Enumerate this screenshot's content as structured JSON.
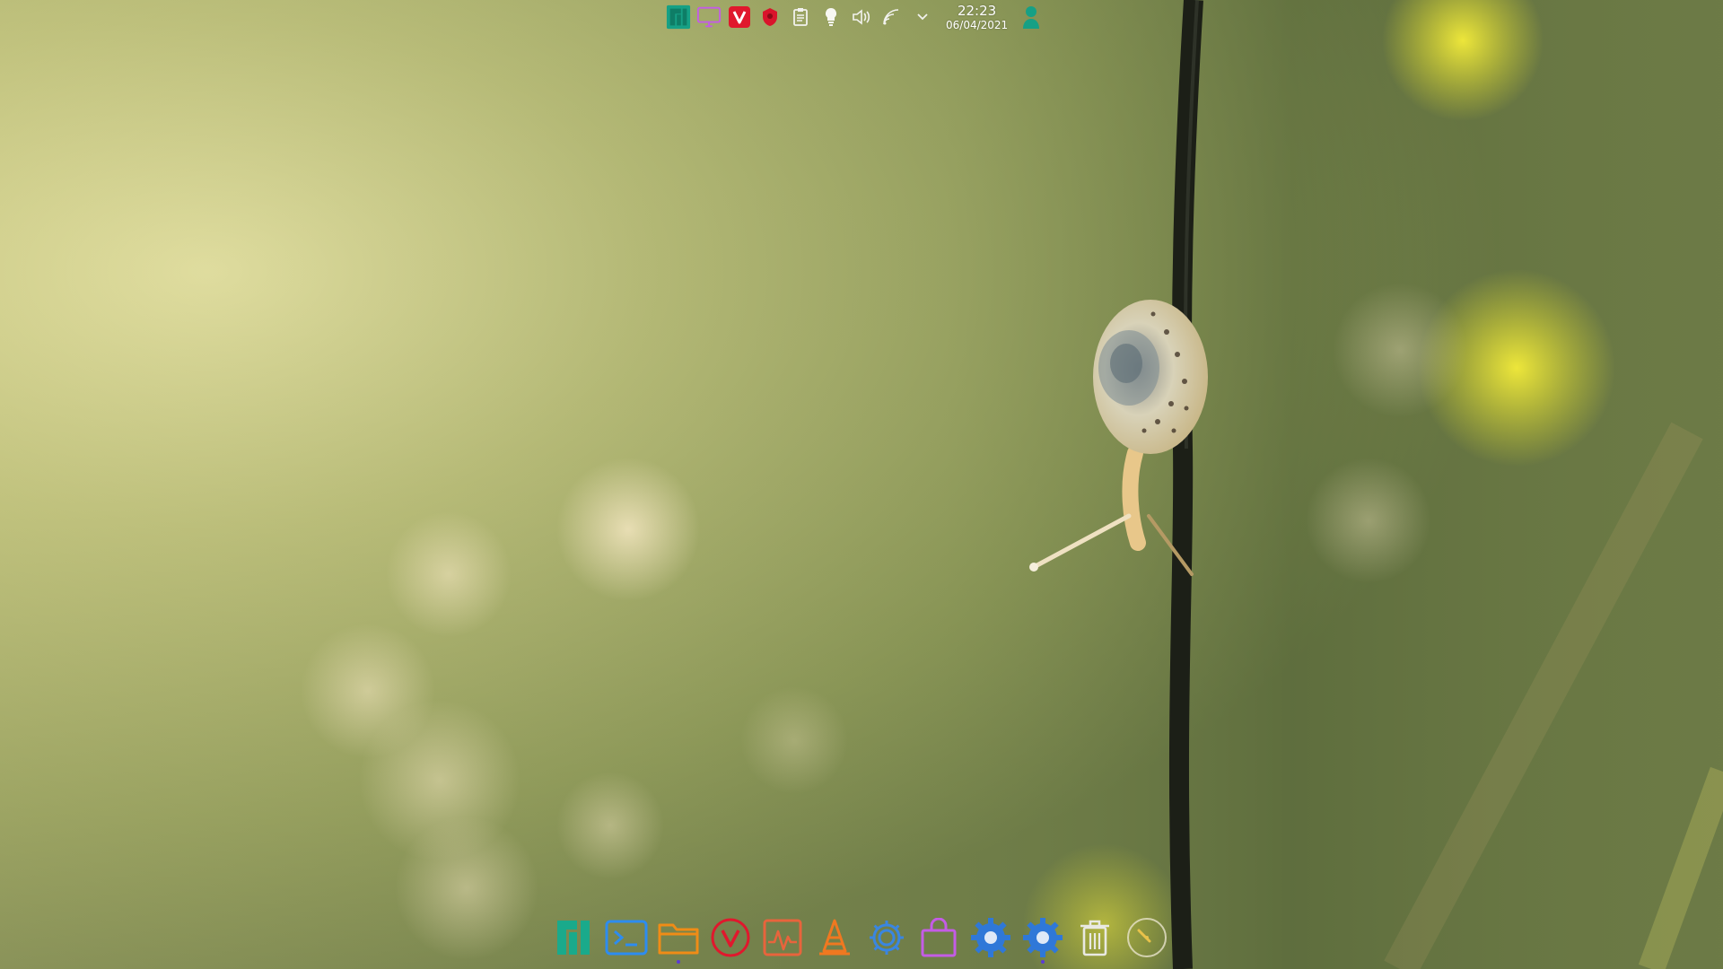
{
  "tray": {
    "items": [
      {
        "name": "manjaro-logo-icon"
      },
      {
        "name": "display-icon"
      },
      {
        "name": "vivaldi-icon"
      },
      {
        "name": "shield-icon"
      },
      {
        "name": "clipboard-icon"
      },
      {
        "name": "lightbulb-icon"
      },
      {
        "name": "volume-icon"
      },
      {
        "name": "wifi-icon"
      },
      {
        "name": "chevron-down-icon"
      }
    ],
    "clock": {
      "time": "22:23",
      "date": "06/04/2021"
    },
    "user": {
      "name": "user-icon"
    }
  },
  "dock": {
    "items": [
      {
        "name": "manjaro-icon",
        "running": false
      },
      {
        "name": "terminal-icon",
        "running": false
      },
      {
        "name": "folder-icon",
        "running": true
      },
      {
        "name": "vivaldi-icon",
        "running": false
      },
      {
        "name": "system-monitor-icon",
        "running": false
      },
      {
        "name": "vlc-cone-icon",
        "running": false
      },
      {
        "name": "settings-gear-icon",
        "running": false
      },
      {
        "name": "shopping-bag-icon",
        "running": false
      },
      {
        "name": "gear-icon",
        "running": false
      },
      {
        "name": "gear-icon",
        "running": true
      },
      {
        "name": "trash-icon",
        "running": false
      },
      {
        "name": "clock-icon",
        "running": false
      }
    ]
  },
  "colors": {
    "manjaro_green": "#16a085",
    "accent_purple": "#c45ce6",
    "vivaldi_red": "#e0182d",
    "terminal_blue": "#2d8cf0",
    "folder_orange": "#f08c16",
    "monitor_orange": "#e8643c",
    "running_dot": "#5b3bd6"
  }
}
